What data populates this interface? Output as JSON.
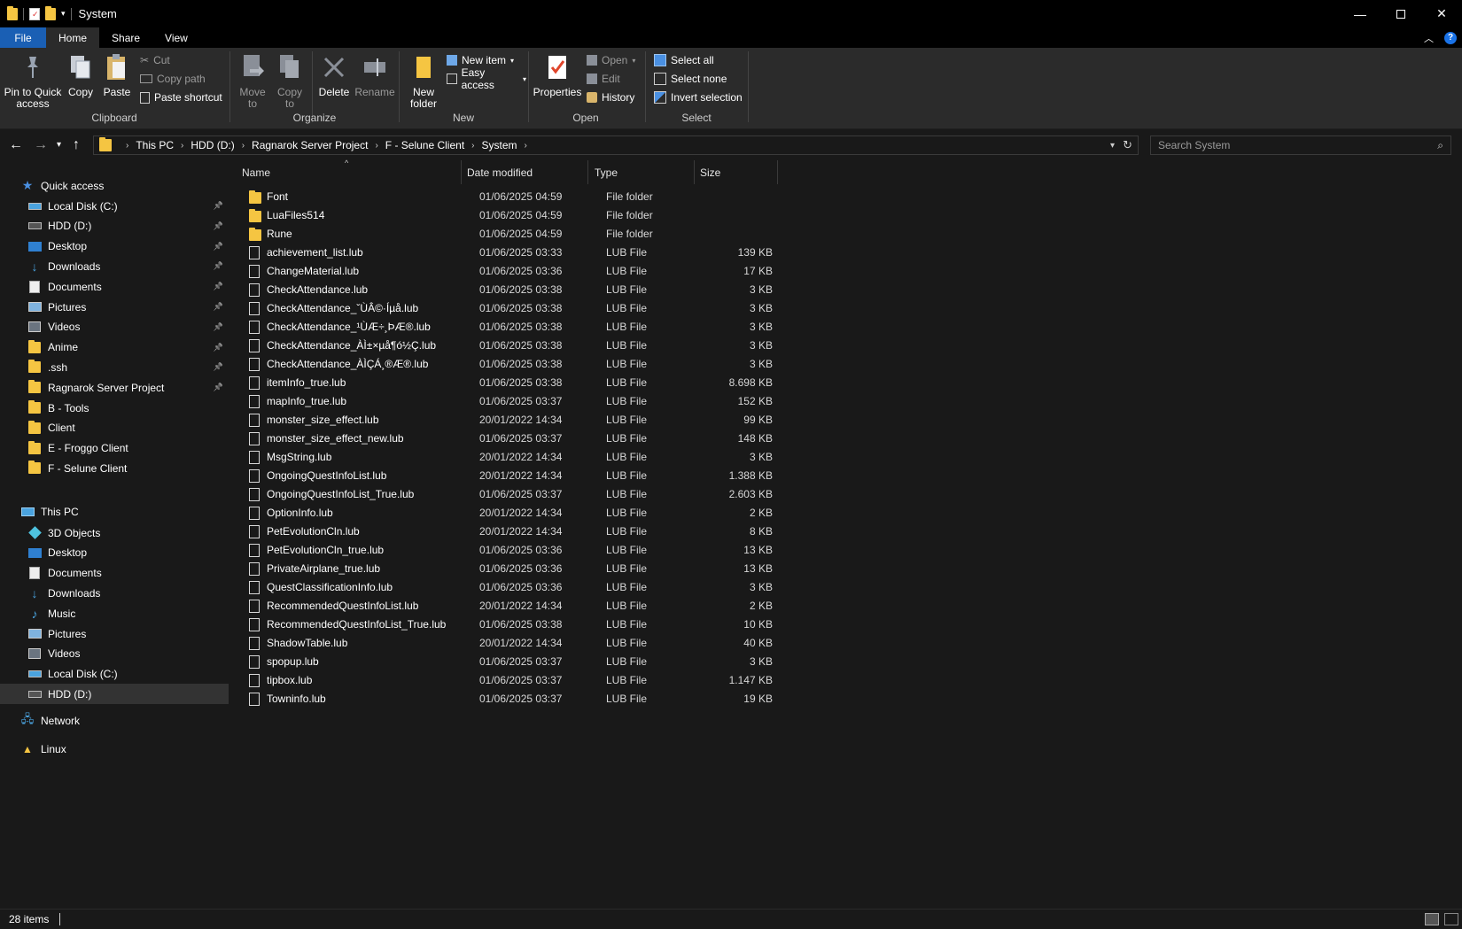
{
  "window": {
    "title": "System"
  },
  "ribbon_tabs": [
    "File",
    "Home",
    "Share",
    "View"
  ],
  "ribbon": {
    "clipboard": {
      "label": "Clipboard",
      "pin_to_quick_access": "Pin to Quick access",
      "copy": "Copy",
      "paste": "Paste",
      "cut": "Cut",
      "copy_path": "Copy path",
      "paste_shortcut": "Paste shortcut"
    },
    "organize": {
      "label": "Organize",
      "move_to": "Move to",
      "copy_to": "Copy to",
      "delete": "Delete",
      "rename": "Rename"
    },
    "new": {
      "label": "New",
      "new_folder": "New folder",
      "new_item": "New item",
      "easy_access": "Easy access"
    },
    "open": {
      "label": "Open",
      "properties": "Properties",
      "open": "Open",
      "edit": "Edit",
      "history": "History"
    },
    "select": {
      "label": "Select",
      "select_all": "Select all",
      "select_none": "Select none",
      "invert_selection": "Invert selection"
    }
  },
  "address": {
    "crumbs": [
      "This PC",
      "HDD (D:)",
      "Ragnarok Server Project",
      "F - Selune Client",
      "System"
    ],
    "search_placeholder": "Search System"
  },
  "nav": {
    "quick_access": "Quick access",
    "quick_items": [
      {
        "label": "Local Disk (C:)",
        "icon": "drive-icon",
        "pinned": true
      },
      {
        "label": "HDD (D:)",
        "icon": "hdd-icon",
        "pinned": true
      },
      {
        "label": "Desktop",
        "icon": "desktop-icon",
        "pinned": true
      },
      {
        "label": "Downloads",
        "icon": "downloads-icon",
        "pinned": true
      },
      {
        "label": "Documents",
        "icon": "documents-icon",
        "pinned": true
      },
      {
        "label": "Pictures",
        "icon": "pictures-icon",
        "pinned": true
      },
      {
        "label": "Videos",
        "icon": "videos-icon",
        "pinned": true
      },
      {
        "label": "Anime",
        "icon": "folder-icon",
        "pinned": true
      },
      {
        "label": ".ssh",
        "icon": "folder-icon",
        "pinned": true
      },
      {
        "label": "Ragnarok Server Project",
        "icon": "folder-icon",
        "pinned": true
      },
      {
        "label": "B - Tools",
        "icon": "folder-icon",
        "pinned": false
      },
      {
        "label": "Client",
        "icon": "folder-icon",
        "pinned": false
      },
      {
        "label": "E - Froggo Client",
        "icon": "folder-icon",
        "pinned": false
      },
      {
        "label": "F - Selune Client",
        "icon": "folder-icon",
        "pinned": false
      }
    ],
    "this_pc": "This PC",
    "pc_items": [
      {
        "label": "3D Objects",
        "icon": "3d-objects-icon"
      },
      {
        "label": "Desktop",
        "icon": "desktop-icon"
      },
      {
        "label": "Documents",
        "icon": "documents-icon"
      },
      {
        "label": "Downloads",
        "icon": "downloads-icon"
      },
      {
        "label": "Music",
        "icon": "music-icon"
      },
      {
        "label": "Pictures",
        "icon": "pictures-icon"
      },
      {
        "label": "Videos",
        "icon": "videos-icon"
      },
      {
        "label": "Local Disk (C:)",
        "icon": "drive-icon"
      },
      {
        "label": "HDD (D:)",
        "icon": "hdd-icon",
        "selected": true
      }
    ],
    "network": "Network",
    "linux": "Linux"
  },
  "columns": {
    "name": "Name",
    "date": "Date modified",
    "type": "Type",
    "size": "Size"
  },
  "files": [
    {
      "name": "Font",
      "date": "01/06/2025 04:59",
      "type": "File folder",
      "size": "",
      "folder": true
    },
    {
      "name": "LuaFiles514",
      "date": "01/06/2025 04:59",
      "type": "File folder",
      "size": "",
      "folder": true
    },
    {
      "name": "Rune",
      "date": "01/06/2025 04:59",
      "type": "File folder",
      "size": "",
      "folder": true
    },
    {
      "name": "achievement_list.lub",
      "date": "01/06/2025 03:33",
      "type": "LUB File",
      "size": "139 KB"
    },
    {
      "name": "ChangeMaterial.lub",
      "date": "01/06/2025 03:36",
      "type": "LUB File",
      "size": "17 KB"
    },
    {
      "name": "CheckAttendance.lub",
      "date": "01/06/2025 03:38",
      "type": "LUB File",
      "size": "3 KB"
    },
    {
      "name": "CheckAttendance_ˇÙÂ©·Íµå.lub",
      "date": "01/06/2025 03:38",
      "type": "LUB File",
      "size": "3 KB"
    },
    {
      "name": "CheckAttendance_¹ÙÆ÷¸ÞÆ®.lub",
      "date": "01/06/2025 03:38",
      "type": "LUB File",
      "size": "3 KB"
    },
    {
      "name": "CheckAttendance_ÀÌ±×µå¶ó½Ç.lub",
      "date": "01/06/2025 03:38",
      "type": "LUB File",
      "size": "3 KB"
    },
    {
      "name": "CheckAttendance_ÀÌÇÁ¸®Æ®.lub",
      "date": "01/06/2025 03:38",
      "type": "LUB File",
      "size": "3 KB"
    },
    {
      "name": "itemInfo_true.lub",
      "date": "01/06/2025 03:38",
      "type": "LUB File",
      "size": "8.698 KB"
    },
    {
      "name": "mapInfo_true.lub",
      "date": "01/06/2025 03:37",
      "type": "LUB File",
      "size": "152 KB"
    },
    {
      "name": "monster_size_effect.lub",
      "date": "20/01/2022 14:34",
      "type": "LUB File",
      "size": "99 KB"
    },
    {
      "name": "monster_size_effect_new.lub",
      "date": "01/06/2025 03:37",
      "type": "LUB File",
      "size": "148 KB"
    },
    {
      "name": "MsgString.lub",
      "date": "20/01/2022 14:34",
      "type": "LUB File",
      "size": "3 KB"
    },
    {
      "name": "OngoingQuestInfoList.lub",
      "date": "20/01/2022 14:34",
      "type": "LUB File",
      "size": "1.388 KB"
    },
    {
      "name": "OngoingQuestInfoList_True.lub",
      "date": "01/06/2025 03:37",
      "type": "LUB File",
      "size": "2.603 KB"
    },
    {
      "name": "OptionInfo.lub",
      "date": "20/01/2022 14:34",
      "type": "LUB File",
      "size": "2 KB"
    },
    {
      "name": "PetEvolutionCln.lub",
      "date": "20/01/2022 14:34",
      "type": "LUB File",
      "size": "8 KB"
    },
    {
      "name": "PetEvolutionCln_true.lub",
      "date": "01/06/2025 03:36",
      "type": "LUB File",
      "size": "13 KB"
    },
    {
      "name": "PrivateAirplane_true.lub",
      "date": "01/06/2025 03:36",
      "type": "LUB File",
      "size": "13 KB"
    },
    {
      "name": "QuestClassificationInfo.lub",
      "date": "01/06/2025 03:36",
      "type": "LUB File",
      "size": "3 KB"
    },
    {
      "name": "RecommendedQuestInfoList.lub",
      "date": "20/01/2022 14:34",
      "type": "LUB File",
      "size": "2 KB"
    },
    {
      "name": "RecommendedQuestInfoList_True.lub",
      "date": "01/06/2025 03:38",
      "type": "LUB File",
      "size": "10 KB"
    },
    {
      "name": "ShadowTable.lub",
      "date": "20/01/2022 14:34",
      "type": "LUB File",
      "size": "40 KB"
    },
    {
      "name": "spopup.lub",
      "date": "01/06/2025 03:37",
      "type": "LUB File",
      "size": "3 KB"
    },
    {
      "name": "tipbox.lub",
      "date": "01/06/2025 03:37",
      "type": "LUB File",
      "size": "1.147 KB"
    },
    {
      "name": "Towninfo.lub",
      "date": "01/06/2025 03:37",
      "type": "LUB File",
      "size": "19 KB"
    }
  ],
  "status": {
    "item_count": "28 items"
  },
  "colors": {
    "accent": "#1a5fb4",
    "folder": "#f5c542",
    "background": "#191919",
    "ribbon": "#2b2b2b"
  }
}
